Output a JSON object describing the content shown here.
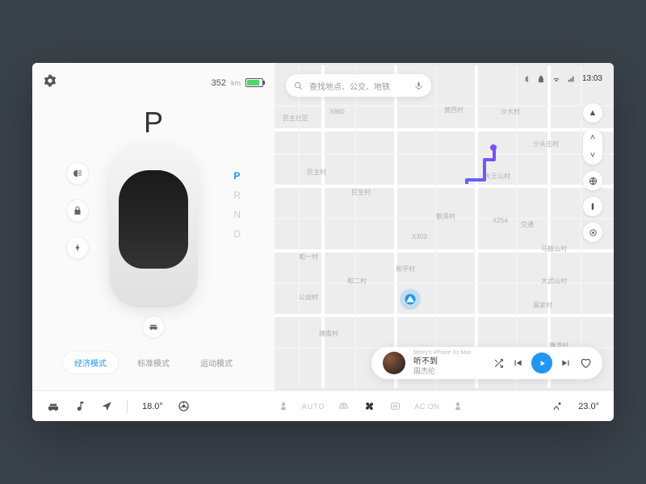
{
  "status_bar": {
    "range_value": "352",
    "range_unit": "km",
    "time": "13:03"
  },
  "gear": {
    "current": "P",
    "options": [
      "P",
      "R",
      "N",
      "D"
    ]
  },
  "side_buttons": {
    "headlights": "headlights-icon",
    "lock": "lock-icon",
    "charge": "charge-icon"
  },
  "modes": {
    "eco": "经济模式",
    "standard": "标准模式",
    "sport": "运动模式"
  },
  "search": {
    "placeholder": "查找地点、公交、地铁"
  },
  "map": {
    "labels": [
      "民主社区",
      "民主村",
      "民生村",
      "和一村",
      "和二村",
      "公益村",
      "塘南村",
      "塘湾村",
      "大王山村",
      "鹅溪村",
      "交通",
      "和平村",
      "马鞍山村",
      "大武山村",
      "沙头庄村",
      "沙大村",
      "黄西村",
      "蒿家村",
      "X860",
      "X254",
      "X303"
    ],
    "route_color_start": "#2196f3",
    "route_color_end": "#7c4dff"
  },
  "player": {
    "source": "Merry's iPhone Xs Max",
    "title": "听不到",
    "artist": "周杰伦"
  },
  "climate": {
    "left_temp": "18.0°",
    "right_temp": "23.0°",
    "auto": "AUTO",
    "ac": "AC ON"
  }
}
